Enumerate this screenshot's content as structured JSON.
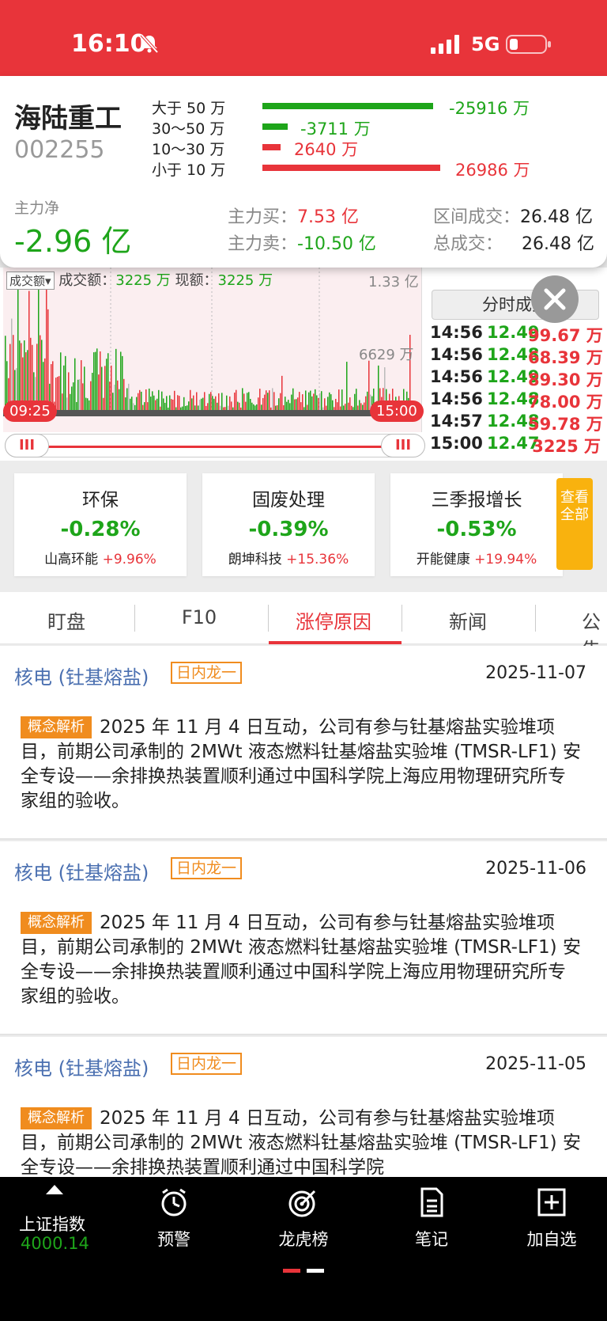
{
  "status": {
    "time": "16:10",
    "network": "5G"
  },
  "stock": {
    "name": "海陆重工",
    "code": "002255"
  },
  "flow": [
    {
      "label": "大于 50 万",
      "value": "-25916 万",
      "color": "#1ea51a",
      "ratio": 0.96
    },
    {
      "label": "30～50 万",
      "value": "-3711 万",
      "color": "#1ea51a",
      "ratio": 0.14
    },
    {
      "label": "10～30 万",
      "value": "2640 万",
      "color": "#e8343a",
      "ratio": 0.1
    },
    {
      "label": "小于 10 万",
      "value": "26986 万",
      "color": "#e8343a",
      "ratio": 1.0
    }
  ],
  "summary": {
    "main_net_label": "主力净",
    "main_net_value": "-2.96 亿",
    "buy_label": "主力买：",
    "buy_value": "7.53 亿",
    "sell_label": "主力卖：",
    "sell_value": "-10.50 亿",
    "range_label": "区间成交：",
    "range_value": "26.48 亿",
    "total_label": "总成交：",
    "total_value": "26.48 亿"
  },
  "chart": {
    "selector": "成交额",
    "head_label1": "成交额：",
    "head_value1": "3225 万",
    "head_label2": "现额：",
    "head_value2": "3225 万",
    "y_top": "1.33 亿",
    "y_mid": "6629 万",
    "start_time": "09:25",
    "end_time": "15:00",
    "handle_glyph": "III"
  },
  "chart_data": {
    "type": "bar",
    "title": "",
    "xlabel": "",
    "ylabel": "",
    "x_range": [
      "09:25",
      "15:00"
    ],
    "ylim": [
      0,
      1.33
    ],
    "y_ticks": [
      "6629 万",
      "1.33 亿"
    ],
    "last_value": "3225 万",
    "grid": true
  },
  "ticks": {
    "button_label": "分时成交",
    "rows": [
      {
        "time": "14:56",
        "price": "12.49",
        "amount": "99.67 万"
      },
      {
        "time": "14:56",
        "price": "12.48",
        "amount": "68.39 万"
      },
      {
        "time": "14:56",
        "price": "12.49",
        "amount": "89.30 万"
      },
      {
        "time": "14:56",
        "price": "12.48",
        "amount": "78.00 万"
      },
      {
        "time": "14:57",
        "price": "12.48",
        "amount": "59.78 万"
      },
      {
        "time": "15:00",
        "price": "12.47",
        "amount": "3225 万"
      }
    ]
  },
  "sectors": [
    {
      "name": "环保",
      "pct": "-0.28%",
      "leader": "山高环能",
      "leader_pct": "+9.96%"
    },
    {
      "name": "固废处理",
      "pct": "-0.39%",
      "leader": "朗坤科技",
      "leader_pct": "+15.36%"
    },
    {
      "name": "三季报增长",
      "pct": "-0.53%",
      "leader": "开能健康",
      "leader_pct": "+19.94%"
    }
  ],
  "view_all": "查看全部",
  "tabs": [
    "盯盘",
    "F10",
    "涨停原因",
    "新闻",
    "公告"
  ],
  "news": [
    {
      "title": "核电 (钍基熔盐)",
      "badge": "日内龙一",
      "date": "2025-11-07",
      "tag": "概念解析",
      "body": "2025 年 11 月 4 日互动，公司有参与钍基熔盐实验堆项目，前期公司承制的 2MWt 液态燃料钍基熔盐实验堆 (TMSR-LF1) 安全专设——余排换热装置顺利通过中国科学院上海应用物理研究所专家组的验收。"
    },
    {
      "title": "核电 (钍基熔盐)",
      "badge": "日内龙一",
      "date": "2025-11-06",
      "tag": "概念解析",
      "body": "2025 年 11 月 4 日互动，公司有参与钍基熔盐实验堆项目，前期公司承制的 2MWt 液态燃料钍基熔盐实验堆 (TMSR-LF1) 安全专设——余排换热装置顺利通过中国科学院上海应用物理研究所专家组的验收。"
    },
    {
      "title": "核电 (钍基熔盐)",
      "badge": "日内龙一",
      "date": "2025-11-05",
      "tag": "概念解析",
      "body": "2025 年 11 月 4 日互动，公司有参与钍基熔盐实验堆项目，前期公司承制的 2MWt 液态燃料钍基熔盐实验堆 (TMSR-LF1) 安全专设——余排换热装置顺利通过中国科学院"
    }
  ],
  "bottom_nav": {
    "index_name": "上证指数",
    "index_value": "4000.14",
    "items": [
      "预警",
      "龙虎榜",
      "笔记",
      "加自选"
    ]
  },
  "colors": {
    "accent": "#e8343a",
    "up": "#e8343a",
    "down": "#1ea51a",
    "badge": "#f08c1e",
    "view_all": "#f9b20e"
  }
}
